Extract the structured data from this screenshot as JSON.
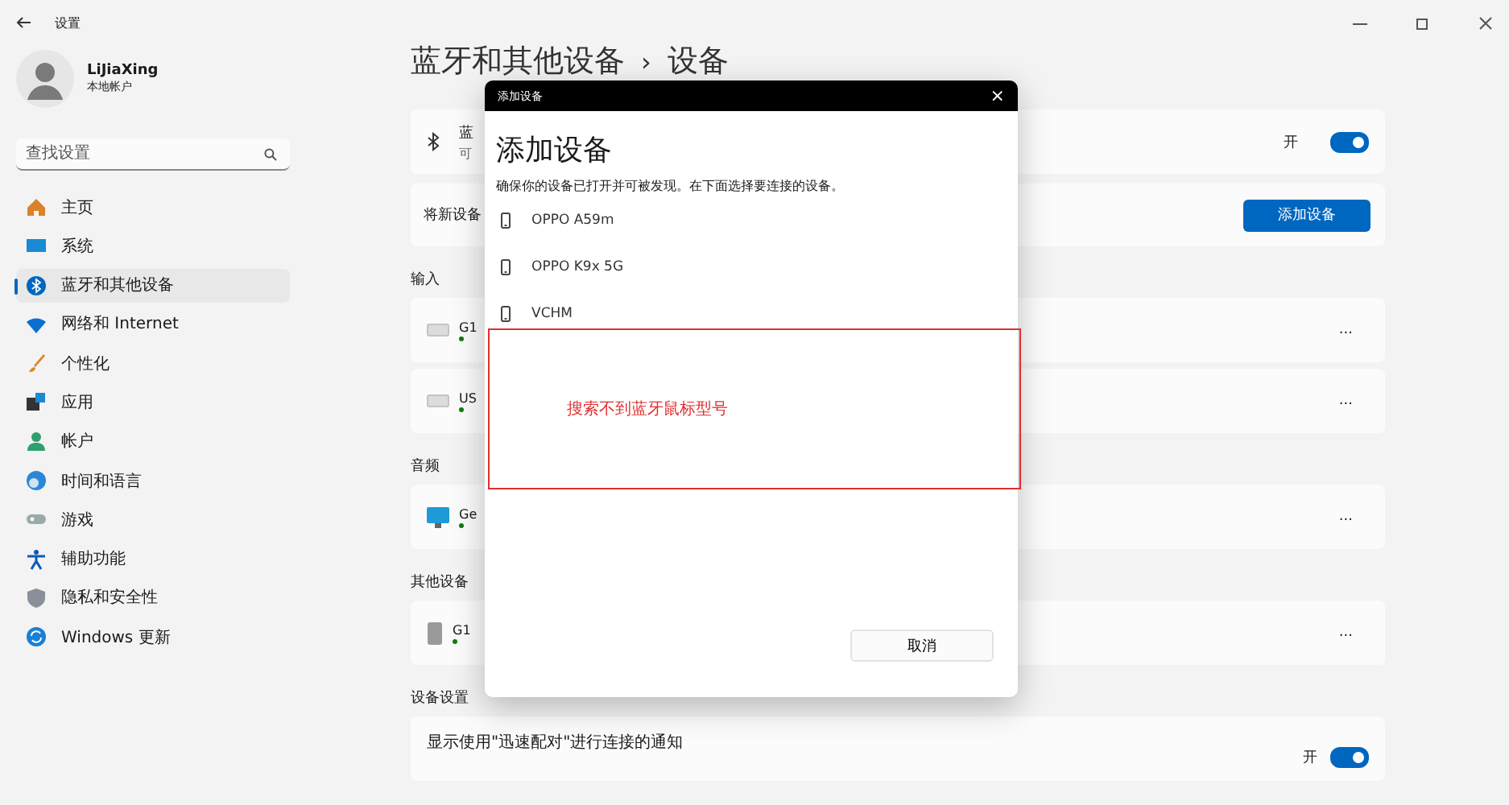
{
  "window": {
    "title": "设置"
  },
  "profile": {
    "name": "LiJiaXing",
    "account": "本地帐户"
  },
  "search": {
    "placeholder": "查找设置"
  },
  "sidebar": {
    "items": [
      {
        "label": "主页",
        "selected": false
      },
      {
        "label": "系统",
        "selected": false
      },
      {
        "label": "蓝牙和其他设备",
        "selected": true
      },
      {
        "label": "网络和 Internet",
        "selected": false
      },
      {
        "label": "个性化",
        "selected": false
      },
      {
        "label": "应用",
        "selected": false
      },
      {
        "label": "帐户",
        "selected": false
      },
      {
        "label": "时间和语言",
        "selected": false
      },
      {
        "label": "游戏",
        "selected": false
      },
      {
        "label": "辅助功能",
        "selected": false
      },
      {
        "label": "隐私和安全性",
        "selected": false
      },
      {
        "label": "Windows 更新",
        "selected": false
      }
    ]
  },
  "breadcrumb": {
    "parent": "蓝牙和其他设备",
    "separator": "›",
    "current": "设备"
  },
  "bluetooth_card": {
    "title": "蓝",
    "subtitle": "可",
    "toggle_label": "开",
    "on": true
  },
  "add_card": {
    "text": "将新设备",
    "button": "添加设备"
  },
  "sections": [
    {
      "title": "输入",
      "devices": [
        {
          "kind": "keyboard",
          "name": "G1",
          "connected": true,
          "more": "..."
        },
        {
          "kind": "keyboard",
          "name": "US",
          "connected": true,
          "more": "..."
        }
      ]
    },
    {
      "title": "音频",
      "devices": [
        {
          "kind": "monitor",
          "name": "Ge",
          "connected": true,
          "more": "..."
        }
      ]
    },
    {
      "title": "其他设备",
      "devices": [
        {
          "kind": "drive",
          "name": "G1",
          "connected": true,
          "more": "..."
        }
      ]
    }
  ],
  "device_settings": {
    "title": "设备设置",
    "setting": "显示使用\"迅速配对\"进行连接的通知",
    "toggle_label": "开",
    "on": true
  },
  "dialog": {
    "title": "添加设备",
    "close": "×",
    "heading": "添加设备",
    "description": "确保你的设备已打开并可被发现。在下面选择要连接的设备。",
    "devices": [
      {
        "name": "OPPO A59m"
      },
      {
        "name": "OPPO K9x 5G"
      },
      {
        "name": "VCHM"
      }
    ],
    "annotation": "搜索不到蓝牙鼠标型号",
    "cancel": "取消"
  }
}
